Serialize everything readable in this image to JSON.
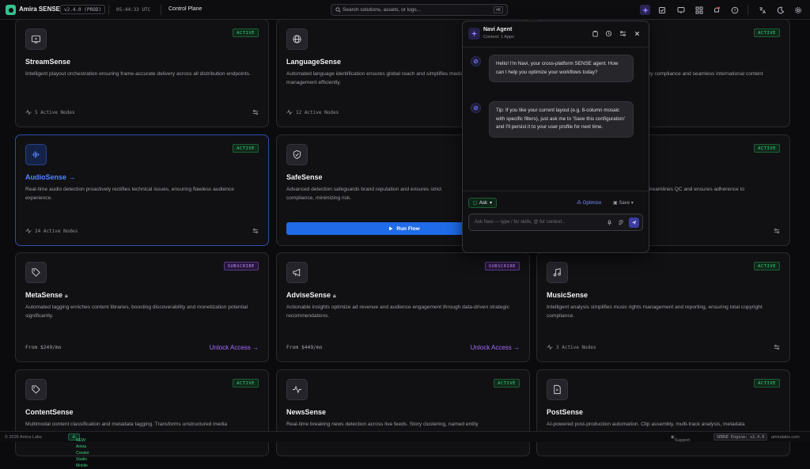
{
  "topbar": {
    "app_name": "Amira SENSE",
    "version": "v2.4.0 (PROD)",
    "clock": "05:44:33 UTC",
    "section": "Control Plane",
    "search_placeholder": "Search solutions, assets, or logs...",
    "search_shortcut": "⌘K",
    "icons": [
      "navi-agent-icon",
      "checklist-icon",
      "monitor-icon",
      "apps-grid-icon",
      "bell-icon",
      "help-icon",
      "translate-icon",
      "theme-moon-icon",
      "settings-gear-icon"
    ]
  },
  "cards": [
    {
      "title": "StreamSense",
      "icon": "tv-icon",
      "badge": "ACTIVE",
      "badge_type": "active",
      "desc": "Intelligent playout orchestration ensuring frame-accurate delivery across all distribution endpoints.",
      "footer": "5 Active Nodes",
      "footer_type": "nodes"
    },
    {
      "title": "LanguageSense",
      "icon": "globe-icon",
      "badge": "ACTIVE",
      "badge_type": "active",
      "desc": "Automated language identification ensures global reach and simplifies media management efficiently.",
      "footer": "12 Active Nodes",
      "footer_type": "nodes"
    },
    {
      "title": "",
      "icon": "",
      "badge": "ACTIVE",
      "badge_type": "active",
      "desc": "...ty compliance and seamless international content",
      "footer": "",
      "footer_type": "none"
    },
    {
      "title": "AudioSense",
      "icon": "waveform-icon",
      "badge": "ACTIVE",
      "badge_type": "active",
      "desc": "Real-time audio detection proactively rectifies technical issues, ensuring flawless audience experience.",
      "footer": "24 Active Nodes",
      "footer_type": "nodes",
      "selected": true,
      "arrow": "→"
    },
    {
      "title": "SafeSense",
      "icon": "shield-check-icon",
      "badge": "",
      "badge_type": "none",
      "desc": "Advanced detection safeguards brand reputation and ensures strict compliance, minimizing risk.",
      "footer": "Run Flow",
      "footer_type": "run"
    },
    {
      "title": "",
      "icon": "",
      "badge": "ACTIVE",
      "badge_type": "active",
      "desc": "...treamlines QC and ensures adherence to",
      "footer": "",
      "footer_type": "none"
    },
    {
      "title": "MetaSense",
      "icon": "tag-icon",
      "badge": "SUBSCRIBE",
      "badge_type": "sub",
      "desc": "Automated tagging enriches content libraries, boosting discoverability and monetization potential significantly.",
      "footer": "From $249/mo",
      "footer_type": "unlock",
      "unlock": "Unlock Access →",
      "locked": true
    },
    {
      "title": "AdviseSense",
      "icon": "megaphone-icon",
      "badge": "SUBSCRIBE",
      "badge_type": "sub",
      "desc": "Actionable insights optimize ad revenue and audience engagement through data-driven strategic recommendations.",
      "footer": "From $449/mo",
      "footer_type": "unlock",
      "unlock": "Unlock Access →",
      "locked": true
    },
    {
      "title": "MusicSense",
      "icon": "music-note-icon",
      "badge": "ACTIVE",
      "badge_type": "active",
      "desc": "Intelligent analysis simplifies music rights management and reporting, ensuring total copyright compliance.",
      "footer": "3 Active Nodes",
      "footer_type": "nodes"
    },
    {
      "title": "ContentSense",
      "icon": "tag-icon",
      "badge": "ACTIVE",
      "badge_type": "active",
      "desc": "Multimodal content classification and metadata tagging. Transforms unstructured media",
      "footer": "",
      "footer_type": "none"
    },
    {
      "title": "NewsSense",
      "icon": "pulse-icon",
      "badge": "ACTIVE",
      "badge_type": "active",
      "desc": "Real-time breaking news detection across live feeds. Story clustering, named entity",
      "footer": "",
      "footer_type": "none"
    },
    {
      "title": "PostSense",
      "icon": "play-file-icon",
      "badge": "ACTIVE",
      "badge_type": "active",
      "desc": "AI-powered post-production automation. Clip assembly, multi-track analysis, metadata",
      "footer": "",
      "footer_type": "none"
    }
  ],
  "agent": {
    "title": "Navi Agent",
    "context": "Context: 1 Apps",
    "messages": [
      "Hello! I'm Navi, your cross-platform SENSE agent. How can I help you optimize your workflows today?",
      "Tip: If you like your current layout (e.g. 8-column mosaic with specific filters), just ask me to 'Save this configuration' and I'll persist it to your user profile for next time."
    ],
    "mode": "Ask",
    "optimize": "Optimize",
    "save": "Save",
    "input_placeholder": "Ask Navi — type / for skills, @ for context..."
  },
  "footer": {
    "copyright": "© 2026 Amira Labs",
    "news": "NEW: Amira Creator Studio Mobile",
    "support": "Support",
    "engine": "SENSE Engine: v2.4.0",
    "domain": "amiralabs.com"
  },
  "colors": {
    "accent": "#36c08f",
    "active": "#3bd17f",
    "subscribe": "#a56cff",
    "link": "#4f86ff",
    "run": "#1f6be8"
  }
}
